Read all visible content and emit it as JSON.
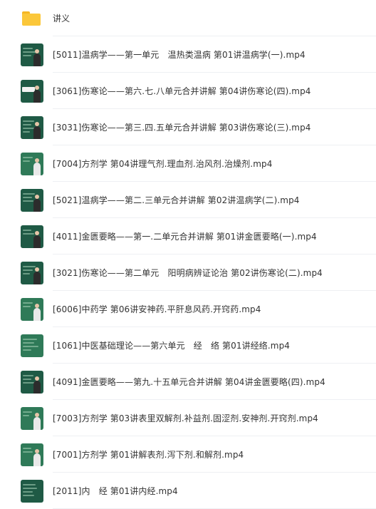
{
  "items": [
    {
      "name": "讲义",
      "type": "folder"
    },
    {
      "name": "[5011]温病学——第一单元　温热类温病 第01讲温病学(一).mp4",
      "type": "video"
    },
    {
      "name": "[3061]伤寒论——第六.七.八单元合并讲解 第04讲伤寒论(四).mp4",
      "type": "video"
    },
    {
      "name": "[3031]伤寒论——第三.四.五单元合并讲解 第03讲伤寒论(三).mp4",
      "type": "video"
    },
    {
      "name": "[7004]方剂学 第04讲理气剂.理血剂.治风剂.治燥剂.mp4",
      "type": "video"
    },
    {
      "name": "[5021]温病学——第二.三单元合并讲解 第02讲温病学(二).mp4",
      "type": "video"
    },
    {
      "name": "[4011]金匮要略——第一.二单元合并讲解 第01讲金匮要略(一).mp4",
      "type": "video"
    },
    {
      "name": "[3021]伤寒论——第二单元　阳明病辨证论治 第02讲伤寒论(二).mp4",
      "type": "video"
    },
    {
      "name": "[6006]中药学 第06讲安神药.平肝息风药.开窍药.mp4",
      "type": "video"
    },
    {
      "name": "[1061]中医基础理论——第六单元　经　络 第01讲经络.mp4",
      "type": "video"
    },
    {
      "name": "[4091]金匮要略——第九.十五单元合并讲解 第04讲金匮要略(四).mp4",
      "type": "video"
    },
    {
      "name": "[7003]方剂学 第03讲表里双解剂.补益剂.固涩剂.安神剂.开窍剂.mp4",
      "type": "video"
    },
    {
      "name": "[7001]方剂学 第01讲解表剂.泻下剂.和解剂.mp4",
      "type": "video"
    },
    {
      "name": "[2011]内　经 第01讲内经.mp4",
      "type": "video"
    }
  ]
}
